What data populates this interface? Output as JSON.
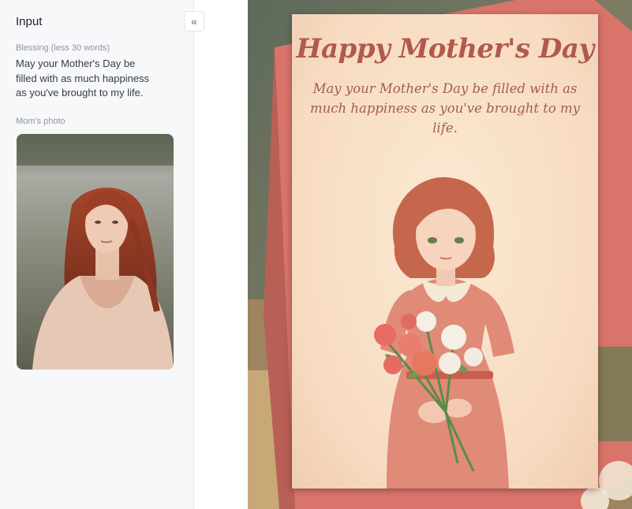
{
  "panel": {
    "title": "Input",
    "collapse_icon": "chevron-double-left-icon",
    "collapse_glyph": "«",
    "blessing_label": "Blessing  (less 30 words)",
    "blessing_value": "May your Mother's Day be filled with as much happiness as you've brought to my life.",
    "photo_label": "Mom's photo"
  },
  "card": {
    "title": "Happy Mother's Day",
    "message": "May your Mother's Day be filled with as much happiness as you've brought to my life."
  },
  "colors": {
    "panel_bg": "#f7f8fa",
    "card_bg": "#f7dbc2",
    "card_title": "#b05a4c",
    "card_text": "#a25d55",
    "envelope": "#d9746a"
  }
}
